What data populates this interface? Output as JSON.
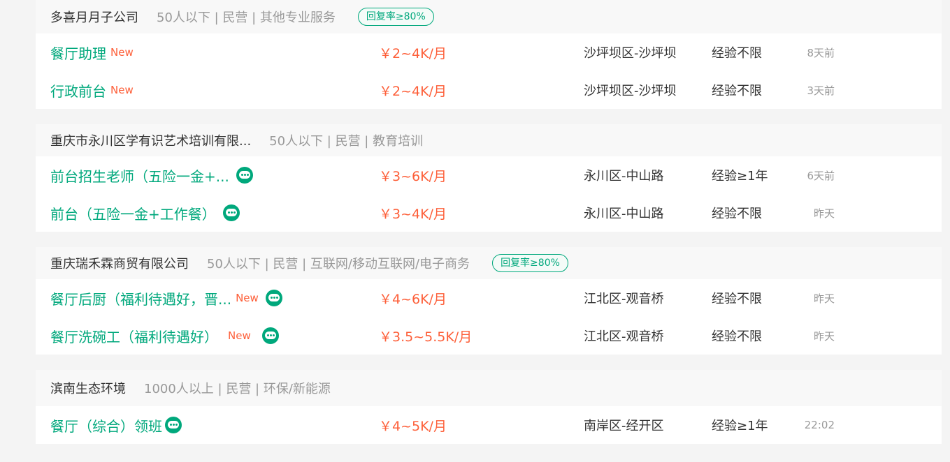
{
  "companies": [
    {
      "name": "多喜月月子公司",
      "meta": "50人以下 | 民营 | 其他专业服务",
      "badge": "回复率≥80%",
      "jobs": [
        {
          "title": "餐厅助理",
          "new": "New",
          "chat": false,
          "salary": "￥2~4K/月",
          "location": "沙坪坝区-沙坪坝",
          "experience": "经验不限",
          "posted": "8天前"
        },
        {
          "title": "行政前台",
          "new": "New",
          "chat": false,
          "salary": "￥2~4K/月",
          "location": "沙坪坝区-沙坪坝",
          "experience": "经验不限",
          "posted": "3天前"
        }
      ]
    },
    {
      "name": "重庆市永川区学有识艺术培训有限...",
      "meta": "50人以下 | 民营 | 教育培训",
      "badge": "",
      "jobs": [
        {
          "title": "前台招生老师（五险一金+...",
          "new": "",
          "chat": true,
          "salary": "￥3~6K/月",
          "location": "永川区-中山路",
          "experience": "经验≥1年",
          "posted": "6天前"
        },
        {
          "title": "前台（五险一金+工作餐）",
          "new": "",
          "chat": true,
          "salary": "￥3~4K/月",
          "location": "永川区-中山路",
          "experience": "经验不限",
          "posted": "昨天"
        }
      ]
    },
    {
      "name": "重庆瑞禾霖商贸有限公司",
      "meta": "50人以下 | 民营 | 互联网/移动互联网/电子商务",
      "badge": "回复率≥80%",
      "jobs": [
        {
          "title": "餐厅后厨（福利待遇好，晋...",
          "new": "New",
          "chat": true,
          "salary": "￥4~6K/月",
          "location": "江北区-观音桥",
          "experience": "经验不限",
          "posted": "昨天"
        },
        {
          "title": "餐厅洗碗工（福利待遇好）",
          "new": "New",
          "chat": true,
          "salary": "￥3.5~5.5K/月",
          "location": "江北区-观音桥",
          "experience": "经验不限",
          "posted": "昨天"
        }
      ]
    },
    {
      "name": "滨南生态环境",
      "meta": "1000人以上 | 民营 | 环保/新能源",
      "badge": "",
      "jobs": [
        {
          "title": "餐厅（综合）领班",
          "new": "",
          "chat": true,
          "salary": "￥4~5K/月",
          "location": "南岸区-经开区",
          "experience": "经验≥1年",
          "posted": "22:02"
        }
      ]
    }
  ],
  "colors": {
    "accent": "#00a87c",
    "salary": "#fd5f39",
    "new_tag": "#fd5f39"
  },
  "icons": {
    "chat": "chat-bubble-icon"
  }
}
